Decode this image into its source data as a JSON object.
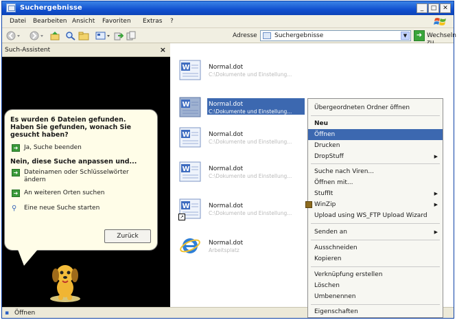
{
  "window": {
    "title": "Suchergebnisse",
    "minimize": "_",
    "maximize": "□",
    "close": "✕"
  },
  "menubar": [
    "Datei",
    "Bearbeiten",
    "Ansicht",
    "Favoriten",
    "Extras",
    "?"
  ],
  "toolbar": {
    "address_label": "Adresse",
    "address_value": "Suchergebnisse",
    "go_label": "Wechseln zu"
  },
  "assistant": {
    "title": "Such-Assistent",
    "close": "×",
    "heading": "Es wurden 6 Dateien gefunden. Haben Sie gefunden, wonach Sie gesucht haben?",
    "yes_option": "Ja, Suche beenden",
    "refine_heading": "Nein, diese Suche anpassen und...",
    "refine_options": [
      "Dateinamen oder Schlüsselwörter ändern",
      "An weiteren Orten suchen",
      "Eine neue Suche starten"
    ],
    "back_button": "Zurück"
  },
  "results": [
    {
      "name": "Normal.dot",
      "path": "C:\\Dokumente und Einstellung..."
    },
    {
      "name": "Normal.dot",
      "path": "C:\\Dokumente und Einstellung..."
    },
    {
      "name": "Normal.dot",
      "path": "C:\\Dokumente und Einstellung..."
    },
    {
      "name": "Normal.dot",
      "path": "C:\\Dokumente und Einstellung..."
    },
    {
      "name": "Normal.dot",
      "path": "C:\\Dokumente und Einstellung..."
    },
    {
      "name": "Normal.dot",
      "path": "Arbeitsplatz"
    }
  ],
  "context_menu": {
    "open_parent": "Übergeordneten Ordner öffnen",
    "new": "Neu",
    "open": "Öffnen",
    "print": "Drucken",
    "dropstuff": "DropStuff",
    "virus_scan": "Suche nach Viren...",
    "open_with": "Öffnen mit...",
    "stuffit": "StuffIt",
    "winzip": "WinZip",
    "ws_ftp": "Upload using WS_FTP Upload Wizard",
    "send_to": "Senden an",
    "cut": "Ausschneiden",
    "copy": "Kopieren",
    "create_shortcut": "Verknüpfung erstellen",
    "delete": "Löschen",
    "rename": "Umbenennen",
    "properties": "Eigenschaften",
    "submenu_arrow": "▶"
  },
  "statusbar": {
    "text": "Öffnen"
  },
  "colors": {
    "titlebar": "#1150cf",
    "selection": "#3c68b0",
    "window_bg": "#ece9d8"
  }
}
